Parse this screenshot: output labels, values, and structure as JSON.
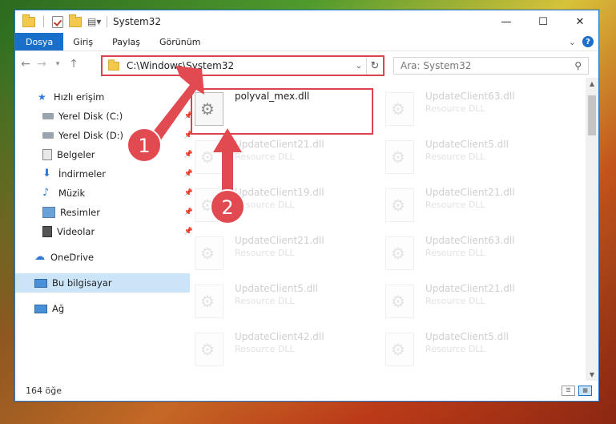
{
  "window": {
    "title": "System32",
    "minimize": "—",
    "maximize": "☐",
    "close": "✕"
  },
  "ribbon": {
    "tabs": [
      "Dosya",
      "Giriş",
      "Paylaş",
      "Görünüm"
    ],
    "collapse": "⌄",
    "help": "?"
  },
  "address": {
    "path": "C:\\Windows\\System32",
    "search_placeholder": "Ara: System32"
  },
  "nav": {
    "items": [
      {
        "label": "Hızlı erişim",
        "icon": "star-icon"
      },
      {
        "label": "Yerel Disk (C:)",
        "icon": "drive-icon"
      },
      {
        "label": "Yerel Disk (D:)",
        "icon": "drive-icon"
      },
      {
        "label": "Belgeler",
        "icon": "documents-icon"
      },
      {
        "label": "İndirmeler",
        "icon": "download-icon"
      },
      {
        "label": "Müzik",
        "icon": "music-icon"
      },
      {
        "label": "Resimler",
        "icon": "pictures-icon"
      },
      {
        "label": "Videolar",
        "icon": "videos-icon"
      },
      {
        "label": "OneDrive",
        "icon": "cloud-icon"
      },
      {
        "label": "Bu bilgisayar",
        "icon": "computer-icon"
      },
      {
        "label": "Ağ",
        "icon": "network-icon"
      }
    ]
  },
  "files": {
    "highlighted": {
      "name": "polyval_mex.dll"
    },
    "items": [
      {
        "name": "UpdateClient63.dll",
        "type": "Resource DLL"
      },
      {
        "name": "UpdateClient21.dll",
        "type": "Resource DLL"
      },
      {
        "name": "UpdateClient5.dll",
        "type": "Resource DLL"
      },
      {
        "name": "UpdateClient19.dll",
        "type": "Resource DLL"
      },
      {
        "name": "UpdateClient21.dll",
        "type": "Resource DLL"
      },
      {
        "name": "UpdateClient21.dll",
        "type": "Resource DLL"
      },
      {
        "name": "UpdateClient63.dll",
        "type": "Resource DLL"
      },
      {
        "name": "UpdateClient5.dll",
        "type": "Resource DLL"
      },
      {
        "name": "UpdateClient21.dll",
        "type": "Resource DLL"
      },
      {
        "name": "UpdateClient42.dll",
        "type": "Resource DLL"
      },
      {
        "name": "UpdateClient5.dll",
        "type": "Resource DLL"
      }
    ]
  },
  "status": {
    "count": "164 öğe"
  },
  "annotations": {
    "step1": "1",
    "step2": "2"
  },
  "colors": {
    "accent": "#1a6fc9",
    "highlight": "#d9444f"
  }
}
